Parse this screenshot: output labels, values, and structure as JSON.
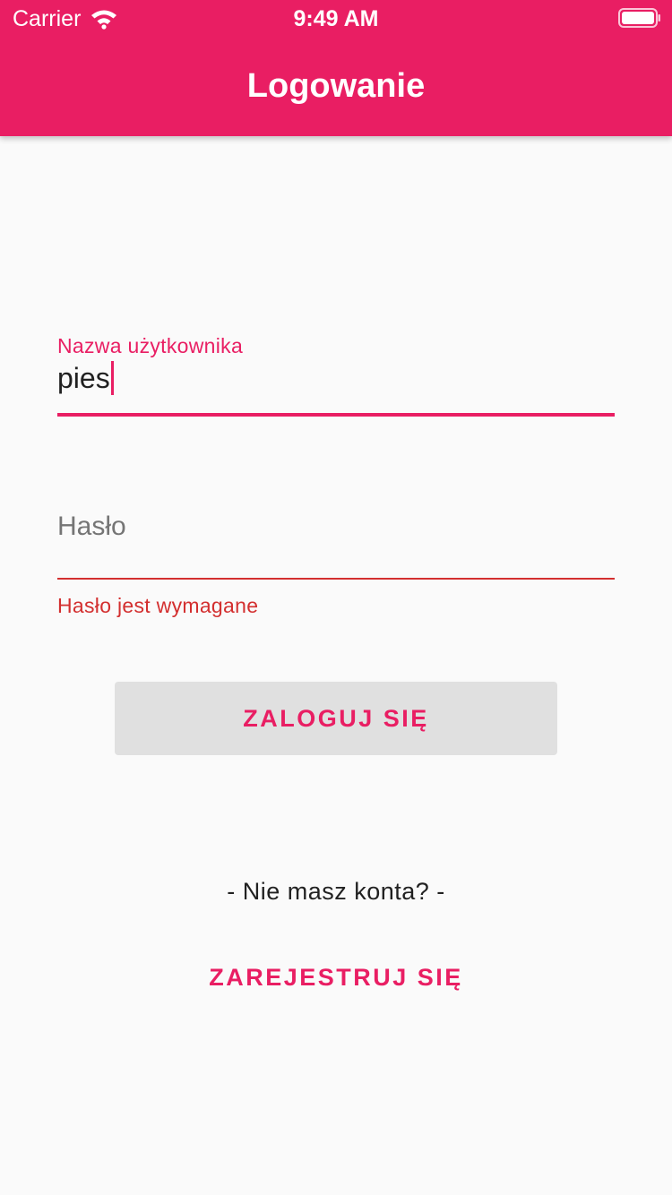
{
  "status_bar": {
    "carrier": "Carrier",
    "time": "9:49 AM",
    "wifi_icon": "wifi-icon",
    "battery_icon": "battery-icon"
  },
  "app_bar": {
    "title": "Logowanie"
  },
  "form": {
    "username": {
      "label": "Nazwa użytkownika",
      "value": "pies"
    },
    "password": {
      "label": "Hasło",
      "value": "",
      "error": "Hasło jest wymagane"
    },
    "login_button_label": "ZALOGUJ SIĘ"
  },
  "footer": {
    "no_account_text": "- Nie masz konta? -",
    "register_button_label": "ZAREJESTRUJ SIĘ"
  },
  "colors": {
    "primary": "#e91e63",
    "error": "#d32f2f",
    "background": "#fafafa",
    "button_bg": "#e0e0e0"
  }
}
